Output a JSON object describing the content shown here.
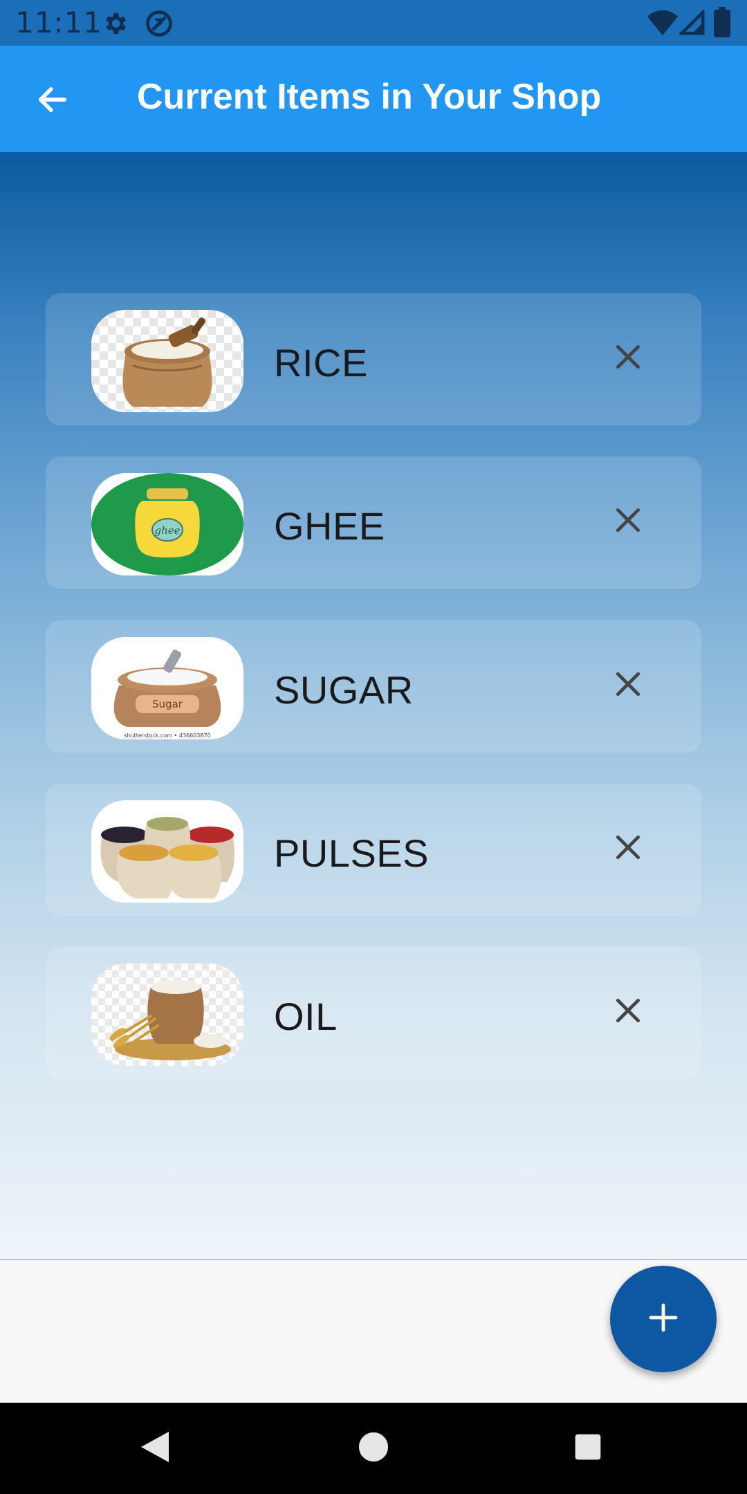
{
  "status_bar": {
    "time": "11:11",
    "icons": [
      "gear-icon",
      "data-saver-icon",
      "wifi-icon",
      "signal-icon",
      "battery-icon"
    ]
  },
  "app_bar": {
    "title": "Current Items in Your Shop",
    "back_icon": "arrow-back-icon"
  },
  "items": [
    {
      "name": "RICE",
      "thumbnail": "rice-sack-image"
    },
    {
      "name": "GHEE",
      "thumbnail": "ghee-jar-image"
    },
    {
      "name": "SUGAR",
      "thumbnail": "sugar-sack-image",
      "thumbnail_text": "Sugar",
      "watermark": "shutterstock.com • 436603870"
    },
    {
      "name": "PULSES",
      "thumbnail": "pulses-sacks-image"
    },
    {
      "name": "OIL",
      "thumbnail": "wheat-sack-image"
    }
  ],
  "remove_icon": "close-icon",
  "fab": {
    "icon": "plus-icon"
  },
  "nav_bar": {
    "icons": [
      "nav-back-icon",
      "nav-home-icon",
      "nav-recents-icon"
    ]
  },
  "colors": {
    "status_bar": "#1a6fb8",
    "app_bar": "#2196f3",
    "fab": "#0d57a3",
    "gradient_top": "#0c5aa0",
    "gradient_bottom": "#eef4fa"
  }
}
